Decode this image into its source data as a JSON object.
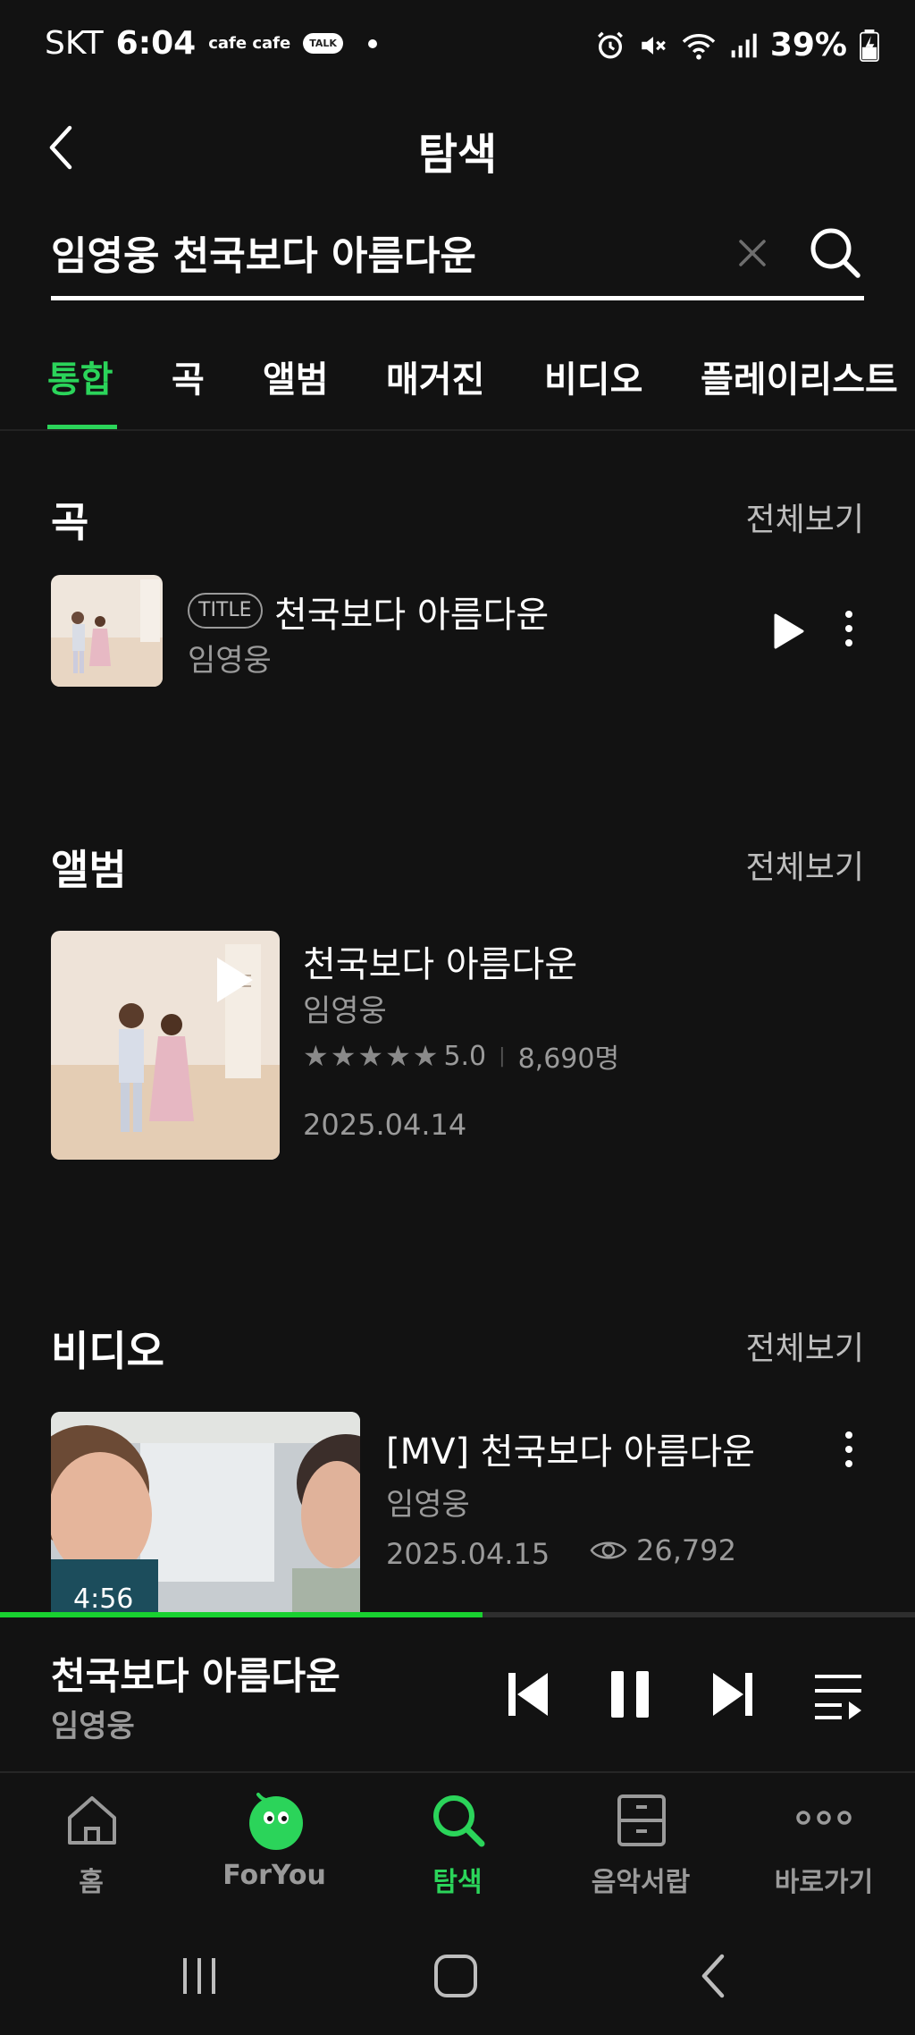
{
  "status_bar": {
    "carrier": "SKT",
    "time": "6:04",
    "notif_apps": "cafe cafe",
    "talk_badge": "TALK",
    "battery": "39%"
  },
  "header": {
    "title": "탐색"
  },
  "search": {
    "query": "임영웅 천국보다 아름다운"
  },
  "tabs": [
    {
      "label": "통합",
      "active": true
    },
    {
      "label": "곡"
    },
    {
      "label": "앨범"
    },
    {
      "label": "매거진"
    },
    {
      "label": "비디오"
    },
    {
      "label": "플레이리스트"
    }
  ],
  "sections": {
    "songs": {
      "title": "곡",
      "see_all": "전체보기",
      "items": [
        {
          "badge": "TITLE",
          "title": "천국보다 아름다운",
          "artist": "임영웅"
        }
      ]
    },
    "albums": {
      "title": "앨범",
      "see_all": "전체보기",
      "items": [
        {
          "title": "천국보다 아름다운",
          "artist": "임영웅",
          "rating": "5.0",
          "rating_count": "8,690명",
          "date": "2025.04.14",
          "stars": 5
        }
      ]
    },
    "videos": {
      "title": "비디오",
      "see_all": "전체보기",
      "items": [
        {
          "title": "[MV] 천국보다 아름다운",
          "artist": "임영웅",
          "date": "2025.04.15",
          "views": "26,792",
          "duration": "4:56"
        }
      ]
    }
  },
  "mini_player": {
    "title": "천국보다 아름다운",
    "artist": "임영웅",
    "progress": 0.527
  },
  "bottom_nav": [
    {
      "label": "홈",
      "icon": "home-icon"
    },
    {
      "label": "ForYou",
      "icon": "foryou-character-icon"
    },
    {
      "label": "탐색",
      "icon": "search-icon",
      "active": true
    },
    {
      "label": "음악서랍",
      "icon": "drawer-icon"
    },
    {
      "label": "바로가기",
      "icon": "more-dots-icon"
    }
  ],
  "colors": {
    "accent": "#2bd45a",
    "background": "#121212",
    "muted_text": "#9a9a9a",
    "progress": "#19d130"
  }
}
